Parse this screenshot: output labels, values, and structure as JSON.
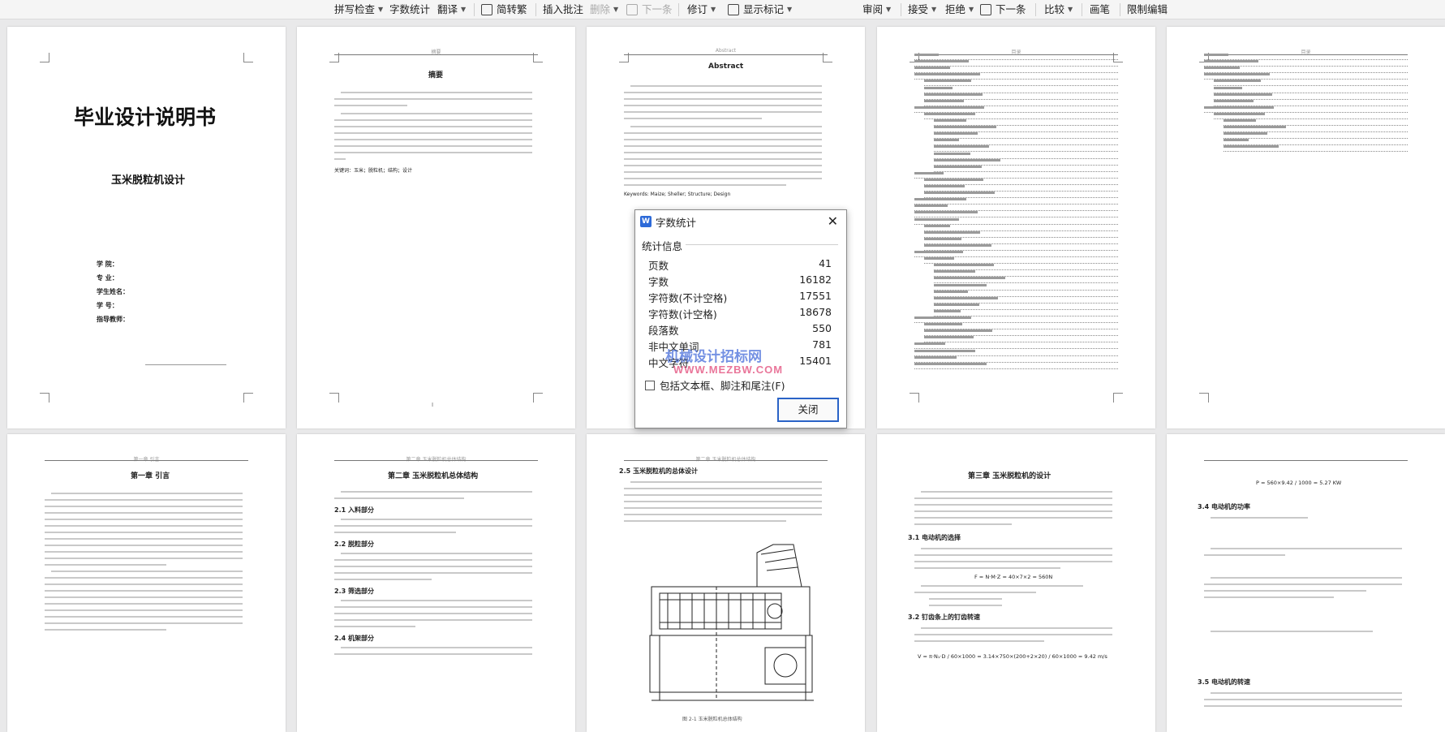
{
  "toolbar": {
    "left_group": [
      {
        "label": "拼写检查",
        "dropdown": true
      },
      {
        "label": "字数统计",
        "dropdown": false
      },
      {
        "label": "翻译",
        "dropdown": true
      },
      {
        "label": "简转繁",
        "dropdown": false
      },
      {
        "label": "插入批注",
        "dropdown": false
      },
      {
        "label": "删除",
        "dropdown": true,
        "disabled": true
      },
      {
        "label": "下一条",
        "dropdown": false,
        "disabled": true
      },
      {
        "label": "修订",
        "dropdown": true
      },
      {
        "label": "显示标记",
        "dropdown": true
      }
    ],
    "right_group": [
      {
        "label": "审阅",
        "dropdown": true
      },
      {
        "label": "接受",
        "dropdown": true
      },
      {
        "label": "拒绝",
        "dropdown": true
      },
      {
        "label": "下一条",
        "dropdown": false
      },
      {
        "label": "比较",
        "dropdown": true
      },
      {
        "label": "画笔",
        "dropdown": false
      },
      {
        "label": "限制编辑",
        "dropdown": false
      }
    ]
  },
  "pages": {
    "cover": {
      "title": "毕业设计说明书",
      "subtitle": "玉米脱粒机设计",
      "fields": [
        "学  院：",
        "专  业：",
        "学生姓名：",
        "学  号：",
        "指导教师："
      ]
    },
    "abstract_cn": {
      "header": "摘要",
      "title": "摘要",
      "keywords": "关键词：玉米；脱粒机；结构；设计"
    },
    "abstract_en": {
      "header": "Abstract",
      "title": "Abstract",
      "keywords": "Keywords: Maize; Sheller; Structure; Design"
    },
    "toc": {
      "header": "目录"
    },
    "chapter1": {
      "header": "第一章 引言",
      "title": "第一章 引言"
    },
    "chapter2": {
      "header": "第二章 玉米脱粒机总体结构",
      "title": "第二章 玉米脱粒机总体结构",
      "sections": [
        "2.1 入料部分",
        "2.2 脱粒部分",
        "2.3 筛选部分",
        "2.4 机架部分"
      ]
    },
    "chapter2_5": {
      "title": "2.5 玉米脱粒机的总体设计",
      "figure_caption": "图 2-1 玉米脱粒机总体结构"
    },
    "chapter3": {
      "title": "第三章 玉米脱粒机的设计",
      "sections": [
        "3.1 电动机的选择",
        "3.2 钉齿条上的钉齿转速"
      ],
      "formula": "F = N·M·Z = 40×7×2 = 560N",
      "formula2": "V = π·N₁·D / 60×1000 = 3.14×750×(200+2×20) / 60×1000 = 9.42 m/s"
    },
    "chapter3_4": {
      "sections": [
        "3.4 电动机的功率",
        "3.5 电动机的转速"
      ],
      "formula": "P = 560×9.42 / 1000 = 5.27 KW"
    }
  },
  "dialog": {
    "title": "字数统计",
    "close_icon": "close-icon",
    "section_label": "统计信息",
    "stats": [
      {
        "label": "页数",
        "value": "41"
      },
      {
        "label": "字数",
        "value": "16182"
      },
      {
        "label": "字符数(不计空格)",
        "value": "17551"
      },
      {
        "label": "字符数(计空格)",
        "value": "18678"
      },
      {
        "label": "段落数",
        "value": "550"
      },
      {
        "label": "非中文单词",
        "value": "781"
      },
      {
        "label": "中文字符",
        "value": "15401"
      }
    ],
    "checkbox_label": "包括文本框、脚注和尾注(F)",
    "checkbox_checked": false,
    "close_button": "关闭"
  },
  "watermark": {
    "line1": "机械设计招标网",
    "line2": "WWW.MEZBW.COM"
  },
  "colors": {
    "accent": "#2a63c7",
    "watermark_blue": "#3a63d8",
    "watermark_red": "#e03b6f"
  }
}
